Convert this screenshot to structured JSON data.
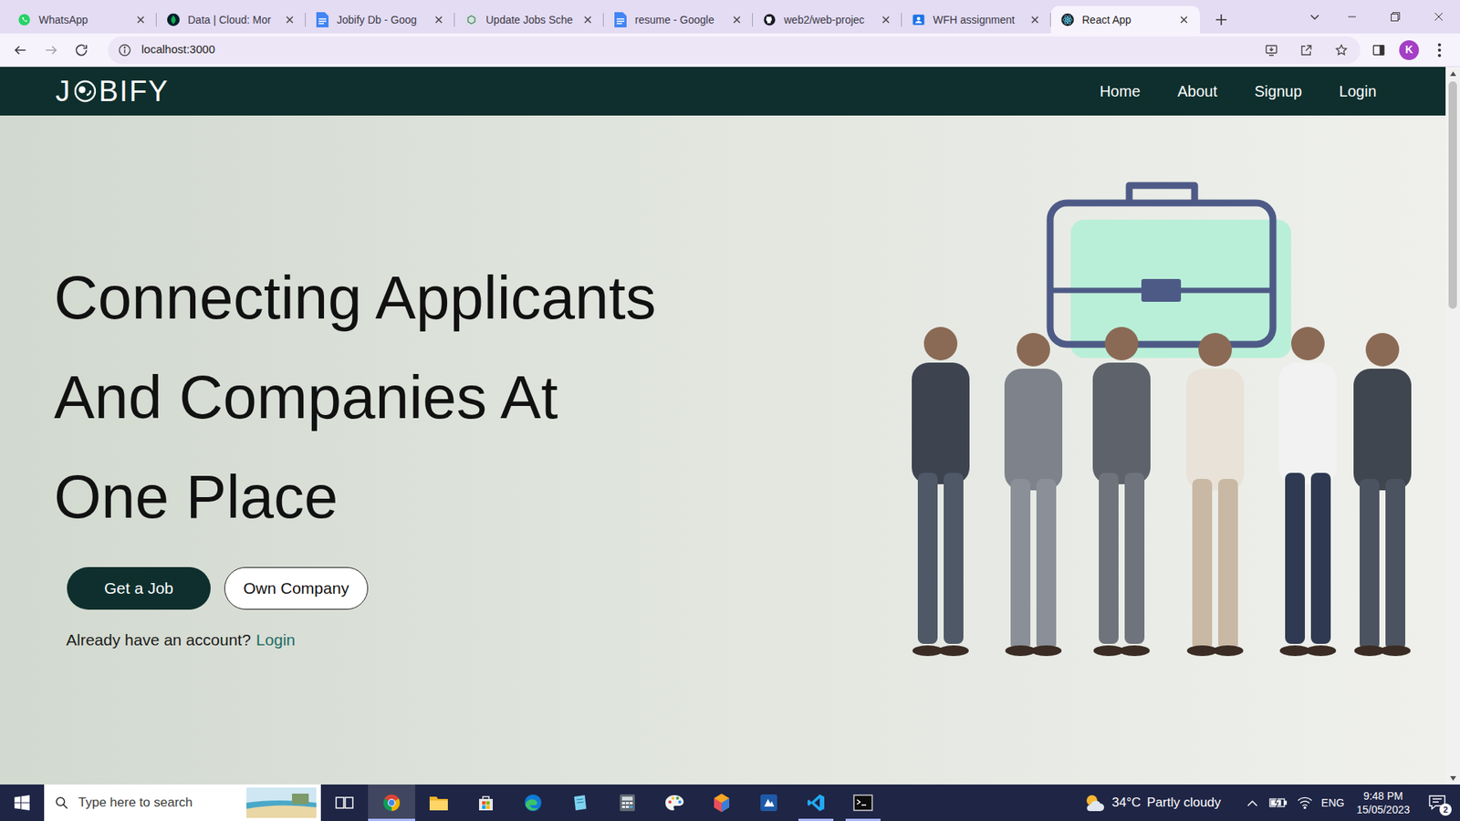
{
  "tabs": [
    {
      "label": "WhatsApp",
      "kind": "whatsapp",
      "selected": false
    },
    {
      "label": "Data | Cloud: Mor",
      "kind": "mongodb",
      "selected": false
    },
    {
      "label": "Jobify Db - Goog",
      "kind": "docs",
      "selected": false
    },
    {
      "label": "Update Jobs Sche",
      "kind": "openai",
      "selected": false
    },
    {
      "label": "resume - Google",
      "kind": "docs",
      "selected": false
    },
    {
      "label": "web2/web-projec",
      "kind": "github",
      "selected": false
    },
    {
      "label": "WFH assignment",
      "kind": "classroom",
      "selected": false
    },
    {
      "label": "React App",
      "kind": "react",
      "selected": true
    }
  ],
  "navigation": {
    "back": {
      "disabled": false
    },
    "forward": {
      "disabled": true
    }
  },
  "address_bar": {
    "url": "localhost:3000"
  },
  "profile": {
    "initial": "K"
  },
  "page": {
    "logo": {
      "left": "J",
      "right": "BIFY"
    },
    "nav": [
      {
        "label": "Home"
      },
      {
        "label": "About"
      },
      {
        "label": "Signup"
      },
      {
        "label": "Login"
      }
    ],
    "hero": {
      "heading": [
        "Connecting Applicants",
        "And Companies At",
        "One Place"
      ],
      "buttons": [
        {
          "label": "Get a Job",
          "kind": "primary"
        },
        {
          "label": "Own Company",
          "kind": "outline"
        }
      ],
      "prompt": "Already have an account?",
      "prompt_link": "Login"
    }
  },
  "scrollbar": {
    "level": 0.33
  },
  "taskbar": {
    "search": {
      "placeholder": "Type here to search"
    },
    "apps": [
      {
        "kind": "taskview",
        "active": false,
        "running": false
      },
      {
        "kind": "chrome",
        "active": true,
        "running": true
      },
      {
        "kind": "explorer",
        "active": false,
        "running": false
      },
      {
        "kind": "store",
        "active": false,
        "running": false
      },
      {
        "kind": "edge",
        "active": false,
        "running": false
      },
      {
        "kind": "notes",
        "active": false,
        "running": false
      },
      {
        "kind": "calculator",
        "active": false,
        "running": false
      },
      {
        "kind": "paint",
        "active": false,
        "running": false
      },
      {
        "kind": "cube",
        "active": false,
        "running": false
      },
      {
        "kind": "app",
        "active": false,
        "running": false
      },
      {
        "kind": "vscode",
        "active": false,
        "running": true
      },
      {
        "kind": "terminal",
        "active": false,
        "running": true
      }
    ],
    "weather": {
      "temp": "34°C",
      "condition": "Partly cloudy"
    },
    "language": "ENG",
    "time": "9:48 PM",
    "date": "15/05/2023",
    "notifications": "2"
  }
}
